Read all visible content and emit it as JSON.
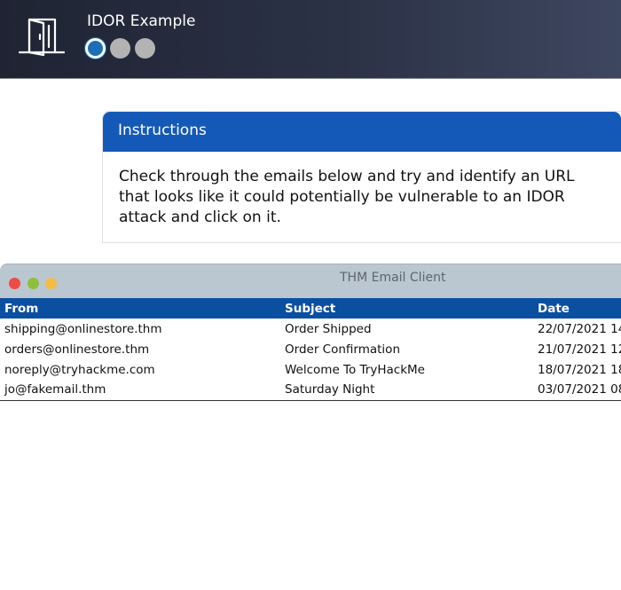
{
  "header": {
    "title": "IDOR Example",
    "icon": "door-icon",
    "steps": [
      {
        "state": "active"
      },
      {
        "state": "inactive"
      },
      {
        "state": "inactive"
      }
    ]
  },
  "instructions": {
    "heading": "Instructions",
    "body": "Check through the emails below and try and identify an URL that looks like it could potentially be vulnerable to an IDOR attack and click on it."
  },
  "email_client": {
    "window_title": "THM Email Client",
    "window_buttons": [
      "close",
      "minimize",
      "maximize"
    ],
    "columns": {
      "from": "From",
      "subject": "Subject",
      "date": "Date"
    },
    "emails": [
      {
        "from": "shipping@onlinestore.thm",
        "subject": "Order Shipped",
        "date": "22/07/2021 14"
      },
      {
        "from": "orders@onlinestore.thm",
        "subject": "Order Confirmation",
        "date": "21/07/2021 12"
      },
      {
        "from": "noreply@tryhackme.com",
        "subject": "Welcome To TryHackMe",
        "date": "18/07/2021 18"
      },
      {
        "from": "jo@fakemail.thm",
        "subject": "Saturday Night",
        "date": "03/07/2021 08"
      }
    ]
  },
  "colors": {
    "header_bg": "#2b3246",
    "step_active": "#1b6fb6",
    "instructions_header": "#1559b8",
    "table_header": "#0b4fa1",
    "titlebar": "#bac6d0"
  }
}
